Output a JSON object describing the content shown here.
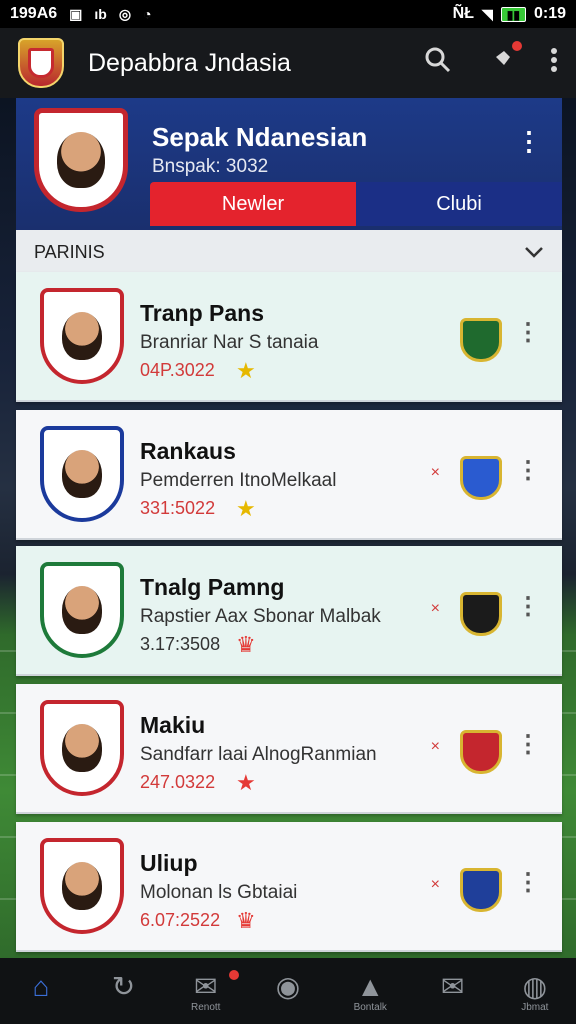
{
  "status_bar": {
    "time_left": "199A6",
    "icons_left": [
      "▣",
      "ıb",
      "◎",
      "◔"
    ],
    "signal_text": "ÑŁ",
    "battery": "▮▮",
    "time_right": "0:19"
  },
  "app": {
    "title": "Depabbra Jndasia",
    "icons": [
      "search-icon",
      "pin-icon",
      "more-vert-icon"
    ]
  },
  "profile": {
    "name": "Sepak Ndanesian",
    "sub": "Bnspak: 3032",
    "tabs": [
      {
        "label": "Newler",
        "active": true
      },
      {
        "label": "Clubi",
        "active": false
      }
    ]
  },
  "section": {
    "title": "PARINIS"
  },
  "players": [
    {
      "name": "Tranp Pans",
      "desc": "Branriar Nar S tanaia",
      "meta": "04P.3022",
      "badge": "★",
      "badge_color": "#e6b800",
      "x": "",
      "crest_color": "#c4262e",
      "club_color": "#1f6a2e",
      "tint": true
    },
    {
      "name": "Rankaus",
      "desc": "Pemderren ItnoMelkaal",
      "meta": "331:5022",
      "badge": "★",
      "badge_color": "#e6b800",
      "x": "×",
      "crest_color": "#1b3a9c",
      "club_color": "#2a5bd0",
      "tint": false
    },
    {
      "name": "Tnalg Pamng",
      "desc": "Rapstier Aax Sbonar Malbak",
      "meta": "3.17:3508",
      "badge": "♛",
      "badge_color": "#e53935",
      "x": "×",
      "crest_color": "#1e7a3a",
      "club_color": "#1b1b1b",
      "tint": true
    },
    {
      "name": "Makiu",
      "desc": "Sandfarr laai AlnogRanmian",
      "meta": "247.0322",
      "badge": "★",
      "badge_color": "#e53935",
      "x": "×",
      "crest_color": "#c4262e",
      "club_color": "#c4262e",
      "tint": false
    },
    {
      "name": "Uliup",
      "desc": "Molonan ls Gbtaiai",
      "meta": "6.07:2522",
      "badge": "♛",
      "badge_color": "#e53935",
      "x": "×",
      "crest_color": "#c4262e",
      "club_color": "#1f3f9a",
      "tint": false
    }
  ],
  "bottom_nav": [
    {
      "icon": "⌂",
      "label": "",
      "active": true
    },
    {
      "icon": "↻",
      "label": "",
      "active": false
    },
    {
      "icon": "✉",
      "label": "Renott",
      "active": false
    },
    {
      "icon": "◉",
      "label": "",
      "active": false
    },
    {
      "icon": "▲",
      "label": "Bontalk",
      "active": false
    },
    {
      "icon": "✉",
      "label": "",
      "active": false
    },
    {
      "icon": "◍",
      "label": "Jbmat",
      "active": false
    }
  ],
  "colors": {
    "accent_red": "#e4232d",
    "accent_blue": "#1b2f86",
    "appbar": "#17191c"
  }
}
